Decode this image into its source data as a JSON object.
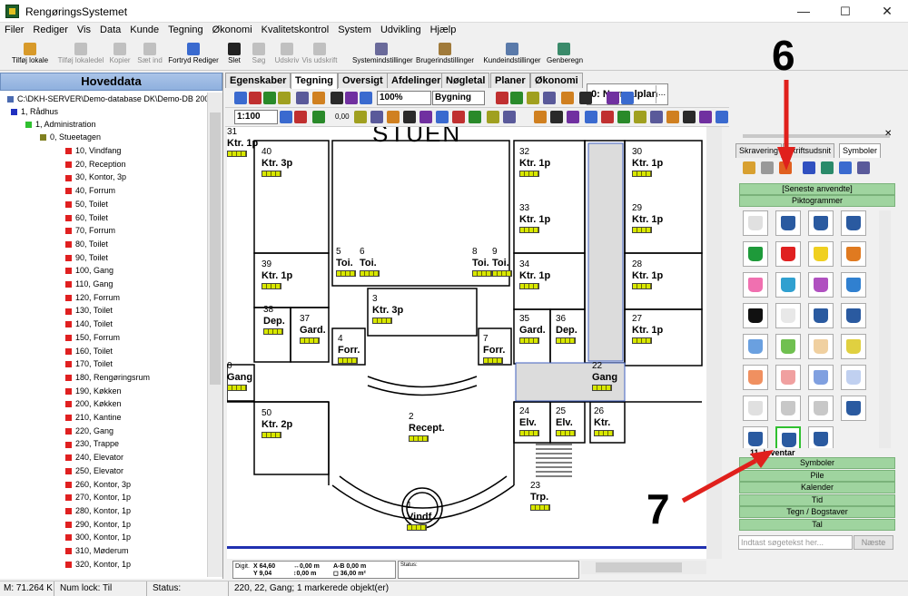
{
  "window": {
    "title": "RengøringsSystemet",
    "minimize": "—",
    "maximize": "☐",
    "close": "✕"
  },
  "menu": [
    "Filer",
    "Rediger",
    "Vis",
    "Data",
    "Kunde",
    "Tegning",
    "Økonomi",
    "Kvalitetskontrol",
    "System",
    "Udvikling",
    "Hjælp"
  ],
  "toolbar": [
    {
      "label": "Tilføj lokale",
      "disabled": false,
      "color": "#d89a2a"
    },
    {
      "label": "Tilføj lokaledel",
      "disabled": true,
      "color": "#c0c0c0"
    },
    {
      "label": "Kopier",
      "disabled": true,
      "color": "#c0c0c0"
    },
    {
      "label": "Sæt ind",
      "disabled": true,
      "color": "#c0c0c0"
    },
    {
      "label": "Fortryd Rediger",
      "disabled": false,
      "color": "#3a6acf"
    },
    {
      "label": "Slet",
      "disabled": false,
      "color": "#222222"
    },
    {
      "label": "Søg",
      "disabled": true,
      "color": "#c0c0c0"
    },
    {
      "label": "Udskriv",
      "disabled": true,
      "color": "#c0c0c0"
    },
    {
      "label": "Vis udskrift",
      "disabled": true,
      "color": "#c0c0c0"
    },
    {
      "label": "Systemindstillinger",
      "disabled": false,
      "color": "#6a6a9a"
    },
    {
      "label": "Brugerindstillinger",
      "disabled": false,
      "color": "#a07a3a"
    },
    {
      "label": "Kundeindstillinger",
      "disabled": false,
      "color": "#5a7aaa"
    },
    {
      "label": "Genberegn",
      "disabled": false,
      "color": "#3a8a6a"
    }
  ],
  "plan_selector": {
    "value": "0: Normalplan",
    "more": "..."
  },
  "left_panel": {
    "title": "Hoveddata",
    "root": "C:\\DKH-SERVER\\Demo-database DK\\Demo-DB 2006",
    "building": "1, Rådhus",
    "department": "1, Administration",
    "floor": "0, Stueetagen",
    "rooms": [
      "10, Vindfang",
      "20, Reception",
      "30, Kontor, 3p",
      "40, Forrum",
      "50, Toilet",
      "60, Toilet",
      "70, Forrum",
      "80, Toilet",
      "90, Toilet",
      "100, Gang",
      "110, Gang",
      "120, Forrum",
      "130, Toilet",
      "140, Toilet",
      "150, Forrum",
      "160, Toilet",
      "170, Toilet",
      "180, Rengøringsrum",
      "190, Køkken",
      "200, Køkken",
      "210, Kantine",
      "220, Gang",
      "230, Trappe",
      "240, Elevator",
      "250, Elevator",
      "260, Kontor, 3p",
      "270, Kontor, 1p",
      "280, Kontor, 1p",
      "290, Kontor, 1p",
      "300, Kontor, 1p",
      "310, Møderum",
      "320, Kontor, 1p"
    ]
  },
  "tabs": [
    {
      "label": "Egenskaber"
    },
    {
      "label": "Tegning",
      "selected": true
    },
    {
      "label": "Oversigt"
    },
    {
      "label": "Afdelinger"
    },
    {
      "label": "Nøgletal"
    },
    {
      "label": "Planer"
    },
    {
      "label": "Økonomi"
    }
  ],
  "drawing_toolbar": {
    "zoom": "100%",
    "view": "Bygning",
    "scale": "1:100",
    "line_width": "0,00"
  },
  "floorplan": {
    "title": "STUEN",
    "rooms": [
      {
        "id": "r40",
        "num": "40",
        "name": "Ktr. 3p"
      },
      {
        "id": "r39",
        "num": "39",
        "name": "Ktr. 1p"
      },
      {
        "id": "r38",
        "num": "38",
        "name": "Dep."
      },
      {
        "id": "r37",
        "num": "37",
        "name": "Gard."
      },
      {
        "id": "r5",
        "num": "5",
        "name": "Toi."
      },
      {
        "id": "r6",
        "num": "6",
        "name": "Toi."
      },
      {
        "id": "r3",
        "num": "3",
        "name": "Ktr. 3p"
      },
      {
        "id": "r4",
        "num": "4",
        "name": "Forr."
      },
      {
        "id": "r0",
        "num": "0",
        "name": "Gang"
      },
      {
        "id": "r50",
        "num": "50",
        "name": "Ktr. 2p"
      },
      {
        "id": "r2",
        "num": "2",
        "name": "Recept."
      },
      {
        "id": "r1",
        "num": "1",
        "name": "Vindf."
      },
      {
        "id": "r8",
        "num": "8",
        "name": "Toi."
      },
      {
        "id": "r9",
        "num": "9",
        "name": "Toi."
      },
      {
        "id": "r7",
        "num": "7",
        "name": "Forr."
      },
      {
        "id": "r32",
        "num": "32",
        "name": "Ktr. 1p"
      },
      {
        "id": "r33",
        "num": "33",
        "name": "Ktr. 1p"
      },
      {
        "id": "r34",
        "num": "34",
        "name": "Ktr. 1p"
      },
      {
        "id": "r35",
        "num": "35",
        "name": "Gard."
      },
      {
        "id": "r36",
        "num": "36",
        "name": "Dep."
      },
      {
        "id": "r22",
        "num": "22",
        "name": "Gang"
      },
      {
        "id": "r24",
        "num": "24",
        "name": "Elv."
      },
      {
        "id": "r25",
        "num": "25",
        "name": "Elv."
      },
      {
        "id": "r26",
        "num": "26",
        "name": "Ktr."
      },
      {
        "id": "r23",
        "num": "23",
        "name": "Trp."
      },
      {
        "id": "r30",
        "num": "30",
        "name": "Ktr. 1p"
      },
      {
        "id": "r31",
        "num": "31",
        "name": "Ktr. 1p"
      },
      {
        "id": "r29",
        "num": "29",
        "name": "Ktr. 1p"
      },
      {
        "id": "r28",
        "num": "28",
        "name": "Ktr. 1p"
      },
      {
        "id": "r27",
        "num": "27",
        "name": "Ktr. 1p"
      }
    ]
  },
  "coords": {
    "digit_label": "Digit.",
    "x": "X 64,60",
    "y": "Y 9,04",
    "dx": "↔0,00 m",
    "dy": "↕0,00 m",
    "ab": "A-B 0,00 m",
    "area": "◻ 36,00 m²"
  },
  "mini_status": "Status:",
  "symbol_panel": {
    "tabs": [
      "Skravering",
      "Skriftsudsnit",
      "Symboler"
    ],
    "recent": "[Seneste anvendte]",
    "pictograms": "Piktogrammer",
    "inventory": "11. Inventar",
    "groups": [
      "Symboler",
      "Pile",
      "Kalender",
      "Tid",
      "Tegn / Bogstaver",
      "Tal"
    ],
    "search_placeholder": "Indtast søgetekst her...",
    "next": "Næste"
  },
  "annotations": {
    "six": "6",
    "seven": "7"
  },
  "statusbar": {
    "mem": "M: 71.264 K",
    "numlock": "Num lock: Til",
    "status": "Status:",
    "info": "220, 22, Gang; 1 markerede objekt(er)"
  },
  "colors": {
    "accent": "#e0201c",
    "header": "#9ab8e4",
    "group": "#9fd49f"
  }
}
